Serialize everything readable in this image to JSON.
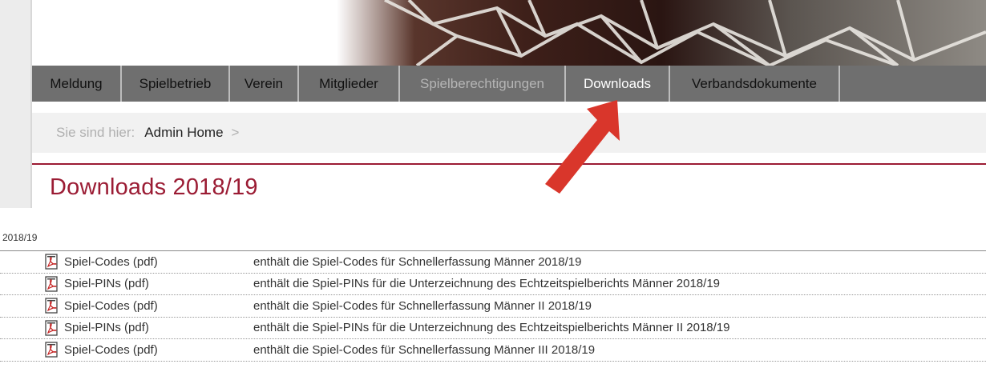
{
  "nav": {
    "items": [
      {
        "label": "Meldung",
        "state": "normal"
      },
      {
        "label": "Spielbetrieb",
        "state": "normal"
      },
      {
        "label": "Verein",
        "state": "normal"
      },
      {
        "label": "Mitglieder",
        "state": "normal"
      },
      {
        "label": "Spielberechtigungen",
        "state": "disabled"
      },
      {
        "label": "Downloads",
        "state": "active"
      },
      {
        "label": "Verbandsdokumente",
        "state": "normal"
      }
    ]
  },
  "breadcrumb": {
    "prefix": "Sie sind hier:",
    "link": "Admin Home",
    "separator": ">"
  },
  "page_title": "Downloads 2018/19",
  "section": {
    "label": "2018/19"
  },
  "downloads": [
    {
      "file": "Spiel-Codes (pdf)",
      "description": "enthält die Spiel-Codes für Schnellerfassung Männer 2018/19",
      "icon": "pdf-icon"
    },
    {
      "file": "Spiel-PINs (pdf)",
      "description": "enthält die Spiel-PINs für die Unterzeichnung des Echtzeitspielberichts Männer 2018/19",
      "icon": "pdf-icon"
    },
    {
      "file": "Spiel-Codes (pdf)",
      "description": "enthält die Spiel-Codes für Schnellerfassung Männer II 2018/19",
      "icon": "pdf-icon"
    },
    {
      "file": "Spiel-PINs (pdf)",
      "description": "enthält die Spiel-PINs für die Unterzeichnung des Echtzeitspielberichts Männer II 2018/19",
      "icon": "pdf-icon"
    },
    {
      "file": "Spiel-Codes (pdf)",
      "description": "enthält die Spiel-Codes für Schnellerfassung Männer III 2018/19",
      "icon": "pdf-icon"
    }
  ],
  "colors": {
    "accent": "#9b1c34",
    "nav_bg": "#6f6f6f",
    "arrow": "#d9362b"
  },
  "annotation_icon": "red-arrow-icon"
}
